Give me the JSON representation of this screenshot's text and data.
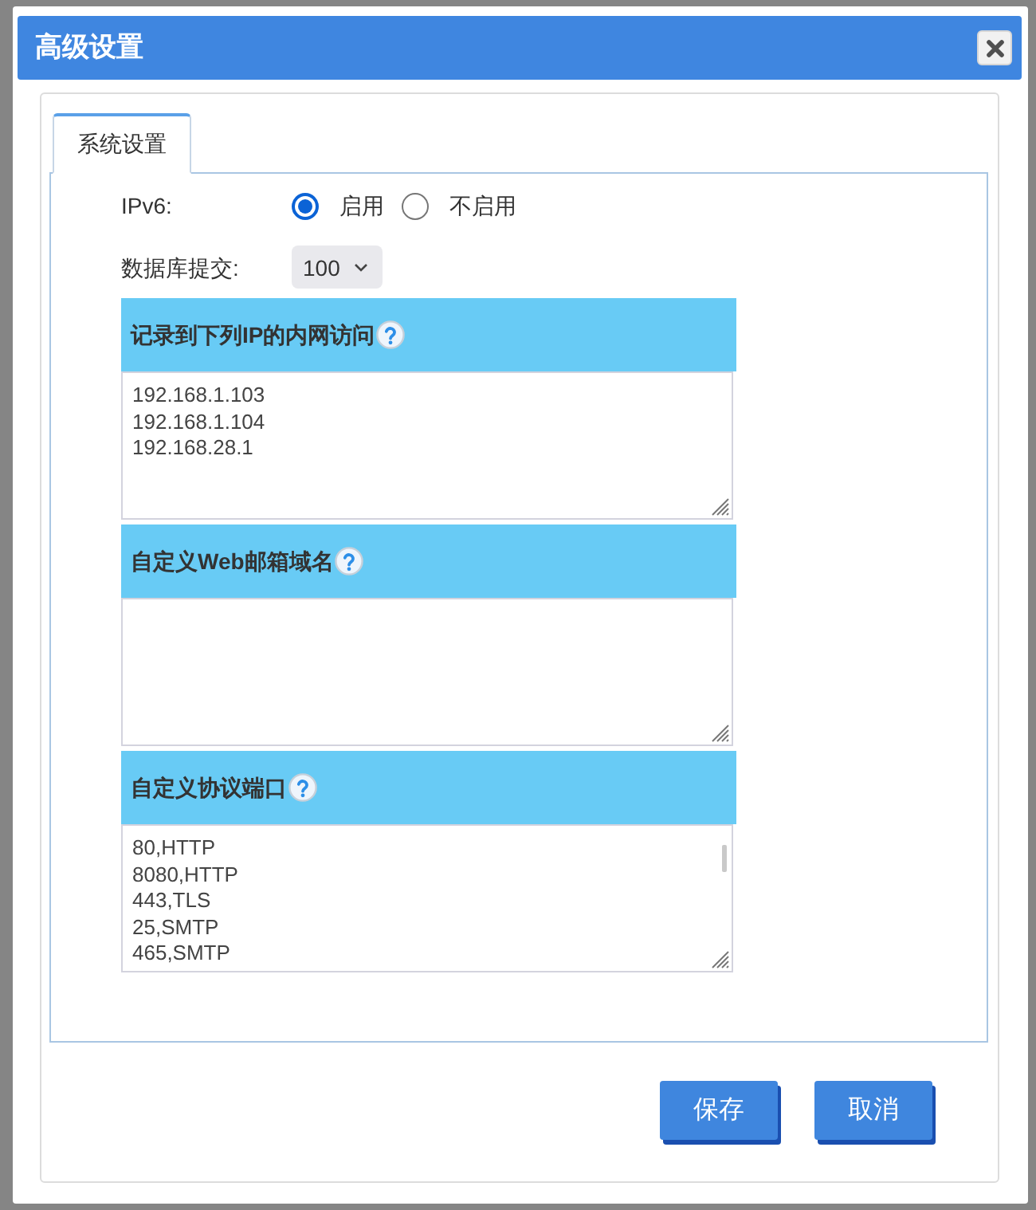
{
  "dialog": {
    "title": "高级设置"
  },
  "tabs": [
    {
      "label": "系统设置",
      "selected": true
    }
  ],
  "ipv6": {
    "label": "IPv6:",
    "options": [
      {
        "label": "启用",
        "selected": true
      },
      {
        "label": "不启用",
        "selected": false
      }
    ]
  },
  "db_commit": {
    "label": "数据库提交:",
    "value": "100"
  },
  "sections": [
    {
      "title": "记录到下列IP的内网访问",
      "lines": [
        "192.168.1.103",
        "192.168.1.104",
        "192.168.28.1"
      ],
      "scrollable": false
    },
    {
      "title": "自定义Web邮箱域名",
      "scrollable": false
    },
    {
      "title": "自定义协议端口",
      "lines": [
        "80,HTTP",
        "8080,HTTP",
        "443,TLS",
        "25,SMTP",
        "465,SMTP"
      ],
      "scrollable": true
    }
  ],
  "buttons": [
    {
      "label": "保存"
    },
    {
      "label": "取消"
    }
  ]
}
